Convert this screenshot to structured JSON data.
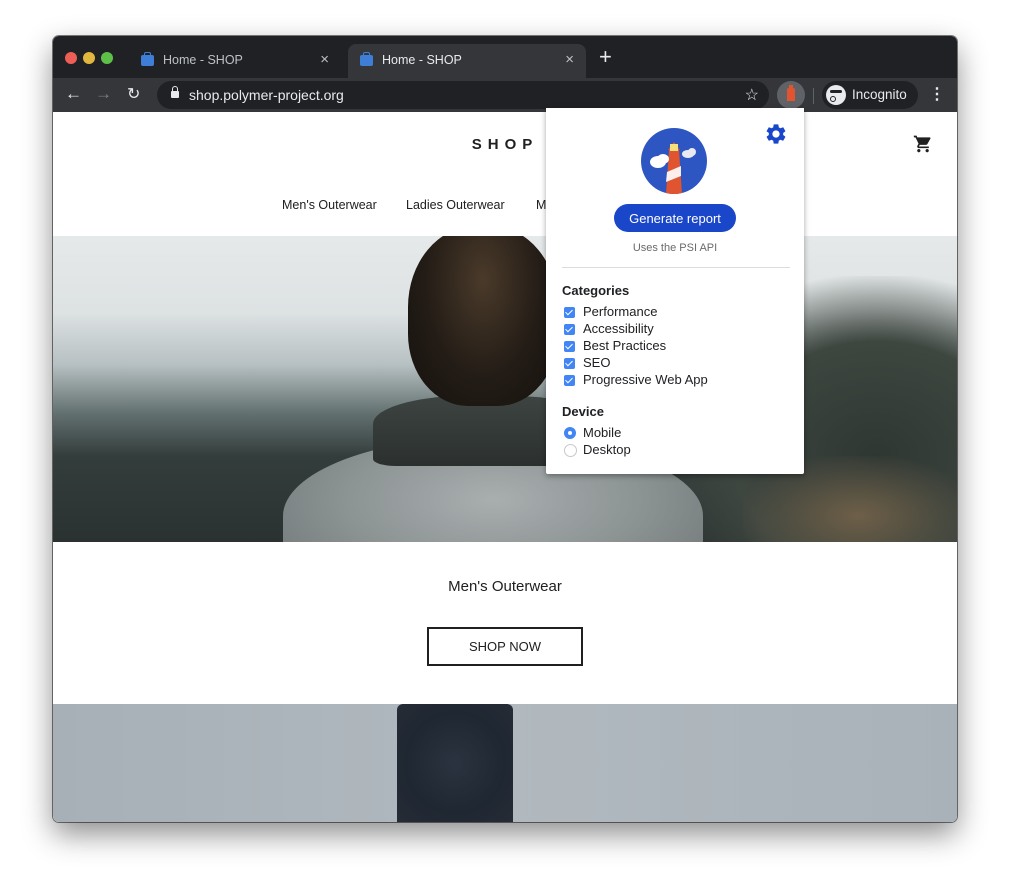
{
  "browser": {
    "tabs": [
      {
        "title": "Home - SHOP",
        "active": false,
        "close": "×"
      },
      {
        "title": "Home - SHOP",
        "active": true,
        "close": "×"
      }
    ],
    "new_tab": "+",
    "nav": {
      "back": "←",
      "forward": "→",
      "reload": "↻"
    },
    "url": "shop.polymer-project.org",
    "bookmark_star": "☆",
    "profile_label": "Incognito",
    "menu": "⋮"
  },
  "page": {
    "logo": "SHOP",
    "nav_links": [
      "Men's Outerwear",
      "Ladies Outerwear",
      "M"
    ],
    "promo": {
      "title": "Men's Outerwear",
      "button": "SHOP NOW"
    }
  },
  "popup": {
    "generate_button": "Generate report",
    "subtitle": "Uses the PSI API",
    "categories_heading": "Categories",
    "categories": [
      {
        "label": "Performance",
        "checked": true
      },
      {
        "label": "Accessibility",
        "checked": true
      },
      {
        "label": "Best Practices",
        "checked": true
      },
      {
        "label": "SEO",
        "checked": true
      },
      {
        "label": "Progressive Web App",
        "checked": true
      }
    ],
    "device_heading": "Device",
    "devices": [
      {
        "label": "Mobile",
        "selected": true
      },
      {
        "label": "Desktop",
        "selected": false
      }
    ],
    "accent_color": "#1a47c9",
    "checkbox_color": "#4285f4"
  }
}
